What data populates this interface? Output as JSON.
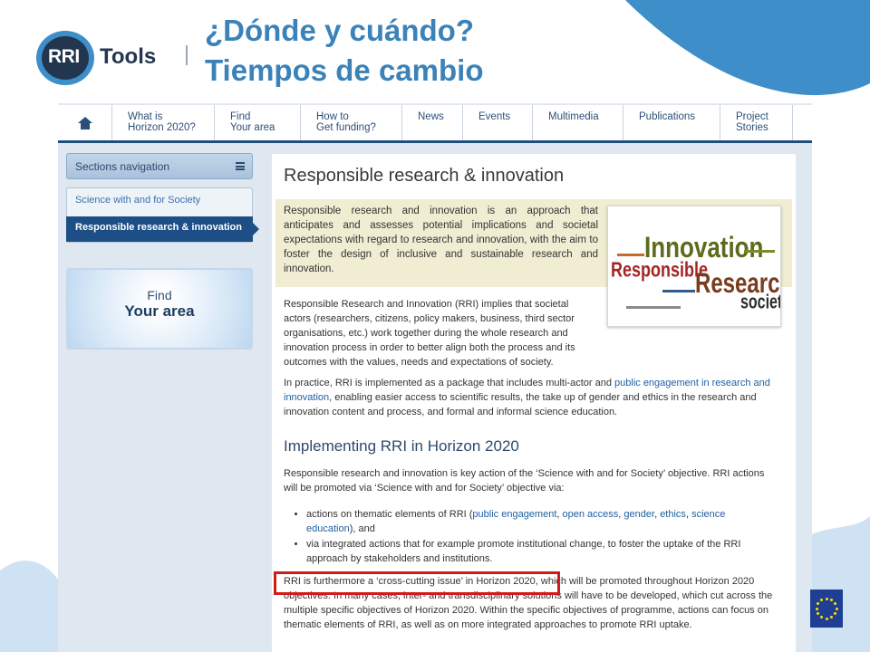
{
  "slide": {
    "title_line1": "¿Dónde y cuándo?",
    "title_line2": "Tiempos de cambio",
    "logo_rri": "RRI",
    "logo_tools": "Tools"
  },
  "nav": {
    "items": [
      {
        "line1": "What is",
        "line2": "Horizon 2020?"
      },
      {
        "line1": "Find",
        "line2": "Your area"
      },
      {
        "line1": "How to",
        "line2": "Get funding?"
      },
      {
        "line1": "News",
        "line2": ""
      },
      {
        "line1": "Events",
        "line2": ""
      },
      {
        "line1": "Multimedia",
        "line2": ""
      },
      {
        "line1": "Publications",
        "line2": ""
      },
      {
        "line1": "Project",
        "line2": "Stories"
      }
    ]
  },
  "sidebar": {
    "sections_label": "Sections navigation",
    "parent_item": "Science with and for Society",
    "active_item": "Responsible research & innovation",
    "find_line1": "Find",
    "find_line2": "Your area"
  },
  "main": {
    "title": "Responsible research & innovation",
    "intro": "Responsible research and innovation is an approach that anticipates and assesses potential implications and societal expectations with regard to research and innovation, with the aim to foster the design of inclusive and sustainable research and innovation.",
    "para1": "Responsible Research and Innovation (RRI) implies that societal actors (researchers, citizens, policy makers, business, third sector organisations, etc.) work together during the whole research and innovation process in order to better align both the process and its outcomes with the values, needs and expectations of society.",
    "para2_pre": "In practice, RRI is implemented as a package that includes multi-actor and ",
    "para2_link": "public engagement in research and innovation",
    "para2_post": ", enabling easier access to scientific results, the take up of gender and ethics in the research and innovation content and process, and formal and informal science education.",
    "heading2": "Implementing RRI in Horizon 2020",
    "para3": "Responsible research and innovation is key action of the ‘Science with and for Society’ objective. RRI actions will be promoted via ‘Science with and for Society’ objective via:",
    "bullet1_pre": "actions on thematic elements of RRI (",
    "bullet1_links": [
      "public engagement",
      "open access",
      "gender",
      "ethics",
      "science education"
    ],
    "bullet1_post": "), and",
    "bullet2": "via integrated actions that for example promote institutional change, to foster the uptake of the RRI approach by stakeholders and institutions.",
    "para4_highlight": "RRI is furthermore a ‘cross-cutting issue’ in Horizon 2020",
    "para4_rest": ", which will be promoted throughout Horizon 2020 objectives. In many cases, inter- and transdisciplinary solutions will have to be developed, which cut across the multiple specific objectives of Horizon 2020. Within the specific objectives of programme, actions can focus on thematic elements of RRI, as well as on more integrated approaches to promote RRI uptake."
  },
  "wordcloud": {
    "words": [
      "Innovation",
      "Responsible",
      "Research",
      "society"
    ]
  },
  "colors": {
    "title": "#3b82b8",
    "nav_text": "#2b4f77",
    "active_item": "#1d4f86",
    "link": "#1f5fa3",
    "highlight_border": "#d11b1b",
    "intro_bg": "#f0edd2"
  }
}
